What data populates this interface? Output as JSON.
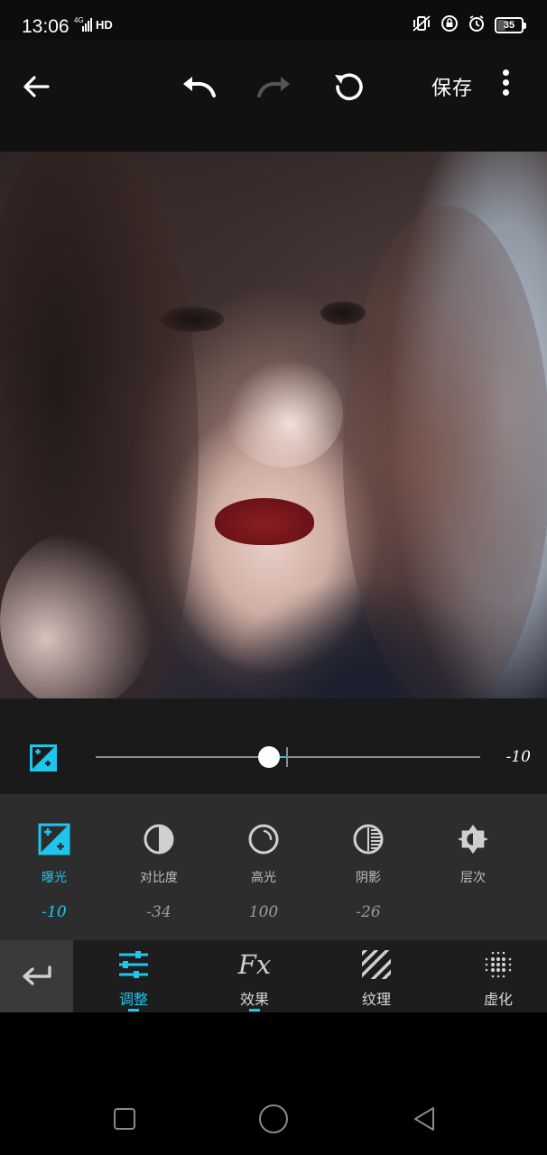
{
  "status_bar": {
    "time": "13:06",
    "network": "4G",
    "hd": "HD",
    "battery": "35",
    "battery_level": 0.35,
    "icons": [
      "vibrate-icon",
      "lock-icon",
      "alarm-icon",
      "battery-icon"
    ]
  },
  "toolbar": {
    "back_icon": "arrow-left-icon",
    "undo_icon": "undo-icon",
    "redo_icon": "redo-icon",
    "reset_icon": "refresh-icon",
    "save_label": "保存",
    "more_icon": "more-vertical-icon"
  },
  "slider": {
    "icon": "exposure-icon",
    "value": "-10",
    "numeric_value": -10,
    "min": -100,
    "max": 100
  },
  "tools": [
    {
      "label": "曝光",
      "value": "-10",
      "icon": "exposure-icon",
      "active": true
    },
    {
      "label": "对比度",
      "value": "-34",
      "icon": "contrast-icon",
      "active": false
    },
    {
      "label": "高光",
      "value": "100",
      "icon": "highlight-icon",
      "active": false
    },
    {
      "label": "阴影",
      "value": "-26",
      "icon": "shadow-icon",
      "active": false
    },
    {
      "label": "层次",
      "value": "",
      "icon": "brightness-icon",
      "active": false
    }
  ],
  "tabs": [
    {
      "label": "调整",
      "icon": "sliders-icon",
      "active": true
    },
    {
      "label": "效果",
      "icon": "fx-icon",
      "icon_text": "Fx",
      "active": false
    },
    {
      "label": "纹理",
      "icon": "texture-icon",
      "active": false
    },
    {
      "label": "虚化",
      "icon": "blur-icon",
      "active": false
    }
  ],
  "colors": {
    "accent": "#20c5ee",
    "toolbar_bg": "#111111",
    "panel_bg": "#2d2d2d"
  }
}
